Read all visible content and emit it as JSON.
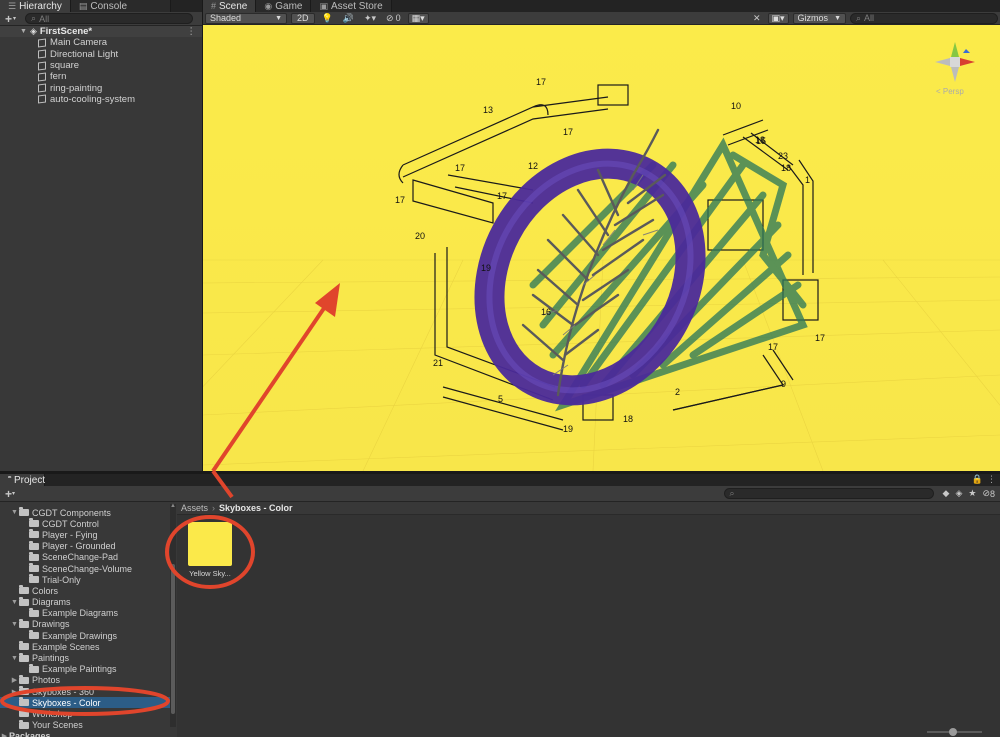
{
  "colors": {
    "accent_red": "#e0452c",
    "sky_yellow": "#fbe94a",
    "ring_purple": "#4b2a9a",
    "scribble_green": "#2f7a5a"
  },
  "hierarchy": {
    "tabs": [
      {
        "label": "Hierarchy",
        "icon": "list-icon"
      },
      {
        "label": "Console",
        "icon": "console-icon"
      }
    ],
    "search_placeholder": "All",
    "scene_name": "FirstScene*",
    "items": [
      "Main Camera",
      "Directional Light",
      "square",
      "fern",
      "ring-painting",
      "auto-cooling-system"
    ]
  },
  "scene": {
    "tabs": [
      {
        "label": "Scene",
        "icon": "grid-icon"
      },
      {
        "label": "Game",
        "icon": "gamepad-icon"
      },
      {
        "label": "Asset Store",
        "icon": "bag-icon"
      }
    ],
    "shading_mode": "Shaded",
    "toggle_2d": "2D",
    "hidden_count": "0",
    "gizmos_label": "Gizmos",
    "search_placeholder": "All",
    "persp_label": "< Persp",
    "part_numbers": [
      "17",
      "13",
      "17",
      "17",
      "17",
      "12",
      "17",
      "20",
      "19",
      "21",
      "5",
      "19",
      "18",
      "2",
      "9",
      "17",
      "17",
      "1",
      "18",
      "23",
      "18",
      "15",
      "10",
      "16"
    ]
  },
  "project": {
    "tab_label": "Project",
    "search_placeholder": "",
    "hidden_packages_count": "8",
    "breadcrumb": [
      "Assets",
      "Skyboxes - Color"
    ],
    "tree": [
      {
        "label": "CGDT Components",
        "indent": 1,
        "expanded": true
      },
      {
        "label": "CGDT Control",
        "indent": 2
      },
      {
        "label": "Player - Fying",
        "indent": 2
      },
      {
        "label": "Player - Grounded",
        "indent": 2
      },
      {
        "label": "SceneChange-Pad",
        "indent": 2
      },
      {
        "label": "SceneChange-Volume",
        "indent": 2
      },
      {
        "label": "Trial-Only",
        "indent": 2
      },
      {
        "label": "Colors",
        "indent": 1
      },
      {
        "label": "Diagrams",
        "indent": 1,
        "expanded": true
      },
      {
        "label": "Example Diagrams",
        "indent": 2
      },
      {
        "label": "Drawings",
        "indent": 1,
        "expanded": true
      },
      {
        "label": "Example Drawings",
        "indent": 2
      },
      {
        "label": "Example Scenes",
        "indent": 1
      },
      {
        "label": "Paintings",
        "indent": 1,
        "expanded": true
      },
      {
        "label": "Example Paintings",
        "indent": 2
      },
      {
        "label": "Photos",
        "indent": 1,
        "collapsed": true
      },
      {
        "label": "Skyboxes - 360",
        "indent": 1,
        "collapsed": true
      },
      {
        "label": "Skyboxes - Color",
        "indent": 1,
        "selected": true
      },
      {
        "label": "Workshop",
        "indent": 1
      },
      {
        "label": "Your Scenes",
        "indent": 1
      },
      {
        "label": "Packages",
        "indent": 0,
        "collapsed": true
      }
    ],
    "asset": {
      "label": "Yellow Sky...",
      "color": "#fbe94a"
    }
  }
}
